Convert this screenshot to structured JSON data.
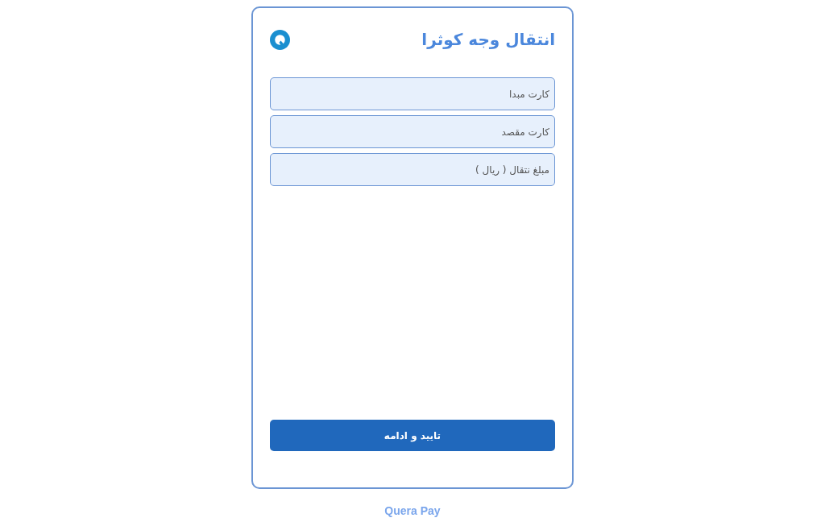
{
  "title": "انتقال وجه کوثرا",
  "fields": [
    {
      "placeholder": "کارت مبدا"
    },
    {
      "placeholder": "کارت مقصد"
    },
    {
      "placeholder": "مبلغ نتقال ( ریال )"
    }
  ],
  "submit_button": "تایید و ادامه",
  "footer": "Quera Pay"
}
